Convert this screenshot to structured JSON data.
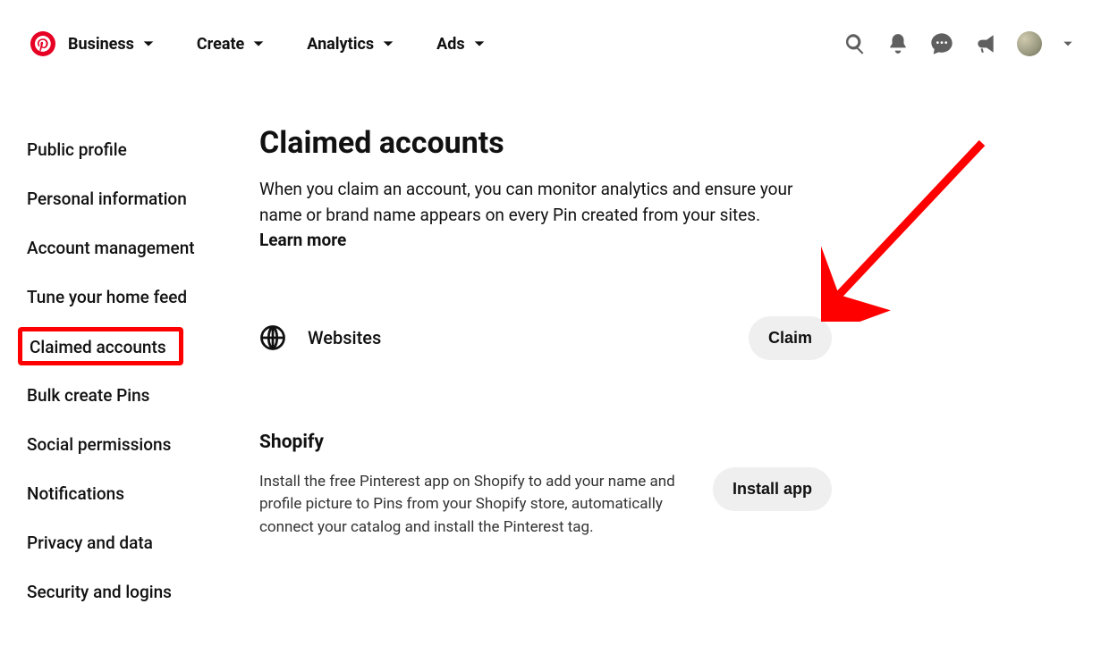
{
  "header": {
    "nav": [
      "Business",
      "Create",
      "Analytics",
      "Ads"
    ]
  },
  "sidebar": {
    "items": [
      "Public profile",
      "Personal information",
      "Account management",
      "Tune your home feed",
      "Claimed accounts",
      "Bulk create Pins",
      "Social permissions",
      "Notifications",
      "Privacy and data",
      "Security and logins"
    ],
    "active_index": 4
  },
  "main": {
    "title": "Claimed accounts",
    "desc_part1": "When you claim an account, you can monitor analytics and ensure your name or brand name appears on every Pin created from your sites. ",
    "learn_more": "Learn more",
    "websites_label": "Websites",
    "claim_button": "Claim",
    "shopify_title": "Shopify",
    "shopify_desc": "Install the free Pinterest app on Shopify to add your name and profile picture to Pins from your Shopify store, automatically connect your catalog and install the Pinterest tag.",
    "install_button": "Install app"
  }
}
